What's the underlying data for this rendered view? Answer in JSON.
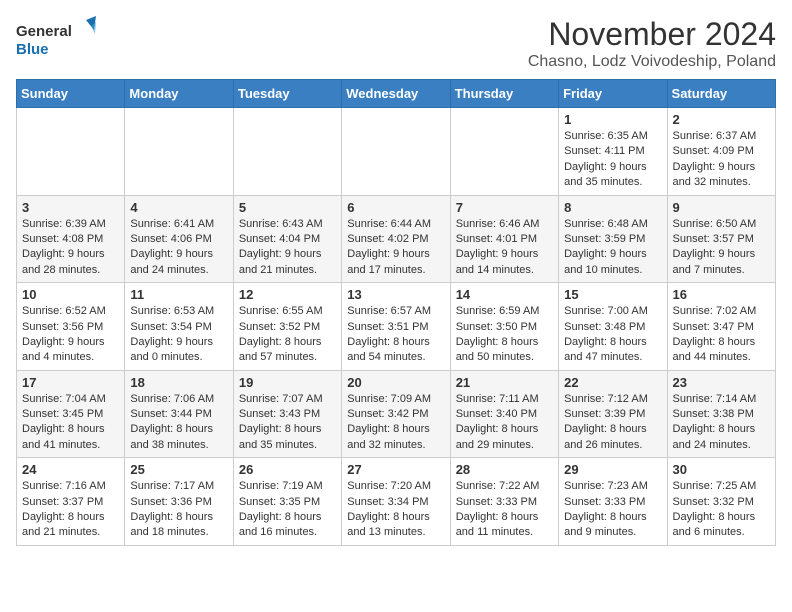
{
  "logo": {
    "line1": "General",
    "line2": "Blue"
  },
  "title": "November 2024",
  "subtitle": "Chasno, Lodz Voivodeship, Poland",
  "weekdays": [
    "Sunday",
    "Monday",
    "Tuesday",
    "Wednesday",
    "Thursday",
    "Friday",
    "Saturday"
  ],
  "weeks": [
    [
      {
        "day": "",
        "info": ""
      },
      {
        "day": "",
        "info": ""
      },
      {
        "day": "",
        "info": ""
      },
      {
        "day": "",
        "info": ""
      },
      {
        "day": "",
        "info": ""
      },
      {
        "day": "1",
        "info": "Sunrise: 6:35 AM\nSunset: 4:11 PM\nDaylight: 9 hours\nand 35 minutes."
      },
      {
        "day": "2",
        "info": "Sunrise: 6:37 AM\nSunset: 4:09 PM\nDaylight: 9 hours\nand 32 minutes."
      }
    ],
    [
      {
        "day": "3",
        "info": "Sunrise: 6:39 AM\nSunset: 4:08 PM\nDaylight: 9 hours\nand 28 minutes."
      },
      {
        "day": "4",
        "info": "Sunrise: 6:41 AM\nSunset: 4:06 PM\nDaylight: 9 hours\nand 24 minutes."
      },
      {
        "day": "5",
        "info": "Sunrise: 6:43 AM\nSunset: 4:04 PM\nDaylight: 9 hours\nand 21 minutes."
      },
      {
        "day": "6",
        "info": "Sunrise: 6:44 AM\nSunset: 4:02 PM\nDaylight: 9 hours\nand 17 minutes."
      },
      {
        "day": "7",
        "info": "Sunrise: 6:46 AM\nSunset: 4:01 PM\nDaylight: 9 hours\nand 14 minutes."
      },
      {
        "day": "8",
        "info": "Sunrise: 6:48 AM\nSunset: 3:59 PM\nDaylight: 9 hours\nand 10 minutes."
      },
      {
        "day": "9",
        "info": "Sunrise: 6:50 AM\nSunset: 3:57 PM\nDaylight: 9 hours\nand 7 minutes."
      }
    ],
    [
      {
        "day": "10",
        "info": "Sunrise: 6:52 AM\nSunset: 3:56 PM\nDaylight: 9 hours\nand 4 minutes."
      },
      {
        "day": "11",
        "info": "Sunrise: 6:53 AM\nSunset: 3:54 PM\nDaylight: 9 hours\nand 0 minutes."
      },
      {
        "day": "12",
        "info": "Sunrise: 6:55 AM\nSunset: 3:52 PM\nDaylight: 8 hours\nand 57 minutes."
      },
      {
        "day": "13",
        "info": "Sunrise: 6:57 AM\nSunset: 3:51 PM\nDaylight: 8 hours\nand 54 minutes."
      },
      {
        "day": "14",
        "info": "Sunrise: 6:59 AM\nSunset: 3:50 PM\nDaylight: 8 hours\nand 50 minutes."
      },
      {
        "day": "15",
        "info": "Sunrise: 7:00 AM\nSunset: 3:48 PM\nDaylight: 8 hours\nand 47 minutes."
      },
      {
        "day": "16",
        "info": "Sunrise: 7:02 AM\nSunset: 3:47 PM\nDaylight: 8 hours\nand 44 minutes."
      }
    ],
    [
      {
        "day": "17",
        "info": "Sunrise: 7:04 AM\nSunset: 3:45 PM\nDaylight: 8 hours\nand 41 minutes."
      },
      {
        "day": "18",
        "info": "Sunrise: 7:06 AM\nSunset: 3:44 PM\nDaylight: 8 hours\nand 38 minutes."
      },
      {
        "day": "19",
        "info": "Sunrise: 7:07 AM\nSunset: 3:43 PM\nDaylight: 8 hours\nand 35 minutes."
      },
      {
        "day": "20",
        "info": "Sunrise: 7:09 AM\nSunset: 3:42 PM\nDaylight: 8 hours\nand 32 minutes."
      },
      {
        "day": "21",
        "info": "Sunrise: 7:11 AM\nSunset: 3:40 PM\nDaylight: 8 hours\nand 29 minutes."
      },
      {
        "day": "22",
        "info": "Sunrise: 7:12 AM\nSunset: 3:39 PM\nDaylight: 8 hours\nand 26 minutes."
      },
      {
        "day": "23",
        "info": "Sunrise: 7:14 AM\nSunset: 3:38 PM\nDaylight: 8 hours\nand 24 minutes."
      }
    ],
    [
      {
        "day": "24",
        "info": "Sunrise: 7:16 AM\nSunset: 3:37 PM\nDaylight: 8 hours\nand 21 minutes."
      },
      {
        "day": "25",
        "info": "Sunrise: 7:17 AM\nSunset: 3:36 PM\nDaylight: 8 hours\nand 18 minutes."
      },
      {
        "day": "26",
        "info": "Sunrise: 7:19 AM\nSunset: 3:35 PM\nDaylight: 8 hours\nand 16 minutes."
      },
      {
        "day": "27",
        "info": "Sunrise: 7:20 AM\nSunset: 3:34 PM\nDaylight: 8 hours\nand 13 minutes."
      },
      {
        "day": "28",
        "info": "Sunrise: 7:22 AM\nSunset: 3:33 PM\nDaylight: 8 hours\nand 11 minutes."
      },
      {
        "day": "29",
        "info": "Sunrise: 7:23 AM\nSunset: 3:33 PM\nDaylight: 8 hours\nand 9 minutes."
      },
      {
        "day": "30",
        "info": "Sunrise: 7:25 AM\nSunset: 3:32 PM\nDaylight: 8 hours\nand 6 minutes."
      }
    ]
  ]
}
